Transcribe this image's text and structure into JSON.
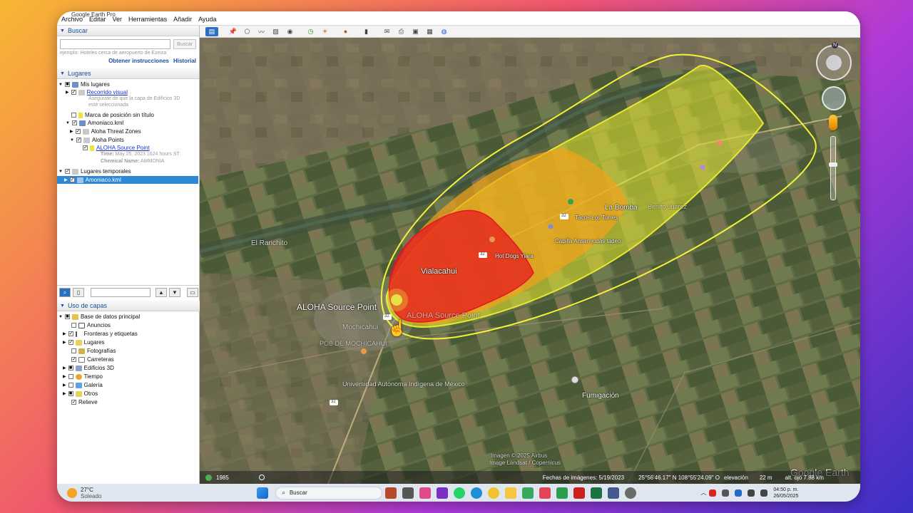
{
  "app": {
    "title": "Google Earth Pro",
    "menu": [
      "Archivo",
      "Editar",
      "Ver",
      "Herramientas",
      "Añadir",
      "Ayuda"
    ]
  },
  "search": {
    "header": "Buscar",
    "button": "Buscar",
    "hint": "ejemplo: Hoteles cerca de aeropuerto de Ezeiza",
    "link_directions": "Obtener instrucciones",
    "link_history": "Historial"
  },
  "places": {
    "header": "Lugares",
    "my_places": "Mis lugares",
    "tour": "Recorrido visual",
    "tour_note_1": "Asegúrate de que la capa de Edificios 3D",
    "tour_note_2": "esté seleccionada",
    "placemark": "Marca de posición sin título",
    "kml": "Amoniaco.kml",
    "threat_zones": "Aloha Threat Zones",
    "points": "Aloha Points",
    "source_point": "ALOHA Source Point",
    "time_label": "Time:",
    "time_value": "May 25, 2023 1624 hours ST",
    "chem_label": "Chemical Name:",
    "chem_value": "AMMONIA",
    "temp_places": "Lugares temporales",
    "temp_kml": "Amoniaco.kml"
  },
  "layers": {
    "header": "Uso de capas",
    "primary": "Base de datos principal",
    "items": [
      "Anuncios",
      "Fronteras y etiquetas",
      "Lugares",
      "Fotografías",
      "Carreteras",
      "Edificios 3D",
      "Tiempo",
      "Galería",
      "Otros",
      "Relieve"
    ]
  },
  "map": {
    "places": {
      "la_bomba": "La Bomba",
      "benito_juarez": "Benito Juárez",
      "el_ranchito": "El Ranchito",
      "vialacahui": "Vialacahui",
      "hot_dogs": "Hot Dogs Yiara",
      "capilla": "Capilla Ansan judas tadeo",
      "fumigacion": "Fumigación",
      "aloha_source": "ALOHA Source Point",
      "aloha_source_shadow": "ALOHA Source Point",
      "mochicahui": "Mochicahui",
      "pob_de_mochicahui": "POB DE MOCHICAHUI",
      "universidad": "Universidad Autónoma Indígena de México",
      "tacos": "Tacos Los Torres",
      "route_32_a": "32",
      "route_32_b": "32",
      "route_32_c": "32",
      "route_32_d": "32"
    },
    "credit_1": "Imagen © 2025 Airbus",
    "credit_2": "Image Landsat / Copernicus",
    "watermark": "Google Earth",
    "compass_n": "N"
  },
  "status": {
    "year": "1985",
    "imagery_date": "Fechas de imágenes: 5/19/2023",
    "coords": "25°56'46.17\" N  108°55'24.09\" O",
    "elevation_label": "elevación",
    "elevation": "22 m",
    "eye_alt": "alt. ojo   7.88 km"
  },
  "taskbar": {
    "temperature": "27°C",
    "weather": "Soleado",
    "search": "Buscar",
    "time": "04:50 p. m.",
    "date": "26/05/2025"
  },
  "colors": {
    "red_zone": "#e8141e",
    "orange_zone": "#f2a31b",
    "yellow_zone": "#e6ea2e",
    "yellow_outline": "#f3f33a"
  }
}
